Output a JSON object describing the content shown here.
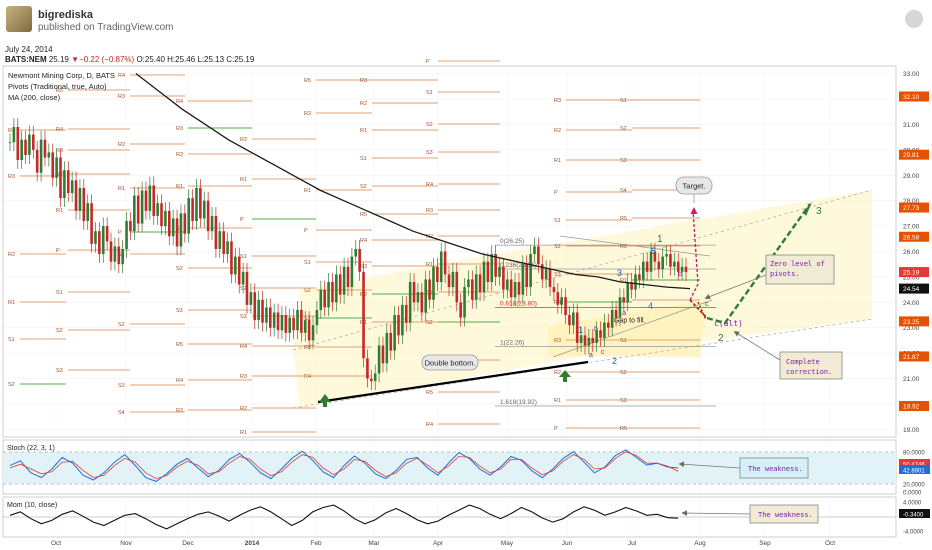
{
  "header": {
    "author": "bigrediska",
    "published": "published on TradingView.com",
    "date": "July 24, 2014",
    "ticker": "BATS:NEM",
    "last": "25.19",
    "change": "▼−0.22 (−0.87%)",
    "ohlc": "O:25.40 H:25.46 L:25.13 C:25.19"
  },
  "legend": {
    "title": "Newmont Mining Corp, D, BATS",
    "pivots": "Pivots (Traditional, true, Auto)",
    "ma": "MA (200, close)"
  },
  "annotations": {
    "target": "Target.",
    "zero_level": "Zero level of pivots.",
    "complete": "Complete correction.",
    "double_bottom": "Double bottom.",
    "gap": "Gap to fill.",
    "calt": "c(alt)",
    "weakness_stoch": "The weakness.",
    "weakness_mom": "The weakness.",
    "fib_0": "0(26.25)",
    "fib_618": "0.618(23.80)",
    "fib_1": "1(22.26)",
    "fib_1618": "1.618(19.92)",
    "fib_236": "0.236(25.31)"
  },
  "pivot_labels": [
    "R4",
    "R3",
    "R2",
    "R1",
    "P",
    "S1",
    "S2",
    "S3",
    "S4",
    "R5",
    "R2",
    "R1",
    "P",
    "S1",
    "S2",
    "S3",
    "R5",
    "R4",
    "R3",
    "R2",
    "R1",
    "S1",
    "S2",
    "R5",
    "R4",
    "R3",
    "R2",
    "R1",
    "P",
    "S1",
    "S2",
    "S3",
    "R4",
    "R3",
    "R2",
    "R1",
    "S1",
    "S2",
    "S3",
    "R5",
    "R4",
    "R3",
    "R2",
    "R1",
    "P",
    "S1",
    "S2",
    "S3"
  ],
  "wave_labels": {
    "w1": "1",
    "w3": "3",
    "w2": "2",
    "w5": "5",
    "w4": "4",
    "wa": "a",
    "wb": "b",
    "wc": "c",
    "big1": "1",
    "big2": "2",
    "big3": "3"
  },
  "chart_data": [
    {
      "type": "line",
      "title": "Newmont Mining Corp, D, BATS",
      "x_tick_labels": [
        "Oct",
        "Nov",
        "Dec",
        "2014",
        "Feb",
        "Mar",
        "Apr",
        "May",
        "Jun",
        "Jul",
        "Aug",
        "Sep",
        "Oct"
      ],
      "y_tick_labels": [
        "33.00",
        "32.00",
        "31.00",
        "30.00",
        "29.00",
        "28.00",
        "27.00",
        "26.00",
        "25.00",
        "24.00",
        "23.00",
        "22.00",
        "21.00",
        "20.00",
        "19.00"
      ],
      "ylim": [
        18.7,
        33.3
      ],
      "price_markers": [
        {
          "label": "32.10",
          "color": "#e65100"
        },
        {
          "label": "29.81",
          "color": "#e65100"
        },
        {
          "label": "27.73",
          "color": "#e65100"
        },
        {
          "label": "26.58",
          "color": "#e65100"
        },
        {
          "label": "25.19",
          "color": "#e53935"
        },
        {
          "label": "24.54",
          "color": "#111111"
        },
        {
          "label": "23.25",
          "color": "#e65100"
        },
        {
          "label": "21.87",
          "color": "#e65100"
        },
        {
          "label": "19.92",
          "color": "#e65100"
        }
      ],
      "series": [
        {
          "name": "NEM",
          "values": [
            30.3,
            30.9,
            29.6,
            30.4,
            29.8,
            30.6,
            30.0,
            29.1,
            30.4,
            29.7,
            29.9,
            28.9,
            29.7,
            28.1,
            29.2,
            28.3,
            28.8,
            27.6,
            28.5,
            27.2,
            27.9,
            26.3,
            26.8,
            25.9,
            27.0,
            26.4,
            25.6,
            26.2,
            25.5,
            26.1,
            27.2,
            26.8,
            28.2,
            27.1,
            28.4,
            27.6,
            28.6,
            27.4,
            27.9,
            27.0,
            27.6,
            26.6,
            27.3,
            26.2,
            27.5,
            26.7,
            28.1,
            27.2,
            28.5,
            27.3,
            28.0,
            26.8,
            27.4,
            26.1,
            26.8,
            25.9,
            26.4,
            25.1,
            25.8,
            24.7,
            25.2,
            23.9,
            24.4,
            23.3,
            24.1,
            23.2,
            23.8,
            23.0,
            23.6,
            22.9,
            23.5,
            22.8,
            23.4,
            22.9,
            23.7,
            22.8,
            23.3,
            22.5,
            23.1,
            23.7,
            24.5,
            23.8,
            24.8,
            24.0,
            25.1,
            24.3,
            25.4,
            24.6,
            25.8,
            26.1,
            25.2,
            21.8,
            21.0,
            20.9,
            21.2,
            22.3,
            21.6,
            22.8,
            22.1,
            23.5,
            22.7,
            23.9,
            23.2,
            24.8,
            24.0,
            24.4,
            23.6,
            24.9,
            24.1,
            25.4,
            24.8,
            26.0,
            25.1,
            24.6,
            25.2,
            24.0,
            23.4,
            24.6,
            24.9,
            24.1,
            25.1,
            24.4,
            25.6,
            24.8,
            25.9,
            25.0,
            25.4,
            24.5,
            24.9,
            24.2,
            24.8,
            24.3,
            25.5,
            24.6,
            25.9,
            26.2,
            25.5,
            24.9,
            25.3,
            24.6,
            24.4,
            23.9,
            24.2,
            23.5,
            23.1,
            23.6,
            22.4,
            22.7,
            22.3,
            22.6,
            22.4,
            22.9,
            22.6,
            23.2,
            23.0,
            23.7,
            23.4,
            24.2,
            24.0,
            24.8,
            24.5,
            25.1,
            24.9,
            25.6,
            25.2,
            26.0,
            25.6,
            25.3,
            25.8,
            25.9,
            25.4,
            25.6,
            25.2,
            25.4,
            25.19
          ]
        },
        {
          "name": "MA (200, close)",
          "values": [
            33.0,
            32.3,
            31.6,
            31.0,
            30.4,
            29.9,
            29.4,
            28.9,
            28.4,
            28.0,
            27.6,
            27.2,
            26.8,
            26.5,
            26.2,
            25.9,
            25.7,
            25.5,
            25.3,
            25.1,
            25.0,
            24.8,
            24.7,
            24.6,
            24.54
          ]
        }
      ]
    },
    {
      "type": "line",
      "title": "Stoch (22, 3, 1)",
      "y_tick_labels": [
        "80.0000",
        "50.4746",
        "42.8901",
        "20.0000",
        "0.0000"
      ],
      "ylim": [
        0,
        100
      ],
      "series": [
        {
          "name": "K",
          "values": [
            55,
            65,
            40,
            30,
            48,
            72,
            60,
            35,
            25,
            40,
            62,
            78,
            55,
            30,
            22,
            38,
            58,
            70,
            50,
            32,
            45,
            68,
            80,
            62,
            40,
            28,
            48,
            70,
            85,
            66,
            42,
            30,
            55,
            75,
            60,
            38,
            28,
            45,
            68,
            72,
            50,
            35,
            60,
            82,
            70,
            48,
            35,
            52,
            74,
            66,
            44,
            30,
            48,
            70,
            84,
            62,
            40,
            52,
            76,
            88,
            72,
            56,
            60,
            52,
            50
          ]
        },
        {
          "name": "D",
          "values": [
            50,
            58,
            48,
            38,
            42,
            62,
            64,
            45,
            30,
            35,
            55,
            70,
            62,
            40,
            28,
            34,
            52,
            64,
            56,
            38,
            42,
            60,
            74,
            68,
            48,
            34,
            42,
            62,
            78,
            72,
            50,
            36,
            48,
            68,
            64,
            45,
            32,
            40,
            60,
            70,
            56,
            40,
            54,
            74,
            72,
            54,
            40,
            48,
            68,
            68,
            50,
            36,
            44,
            64,
            78,
            68,
            48,
            50,
            70,
            84,
            76,
            60,
            60,
            54,
            43
          ]
        }
      ]
    },
    {
      "type": "line",
      "title": "Mom (10, close)",
      "y_tick_labels": [
        "4.0000",
        "0.0000",
        "-0.3400",
        "-4.0000"
      ],
      "ylim": [
        -5,
        5
      ],
      "series": [
        {
          "name": "Mom",
          "values": [
            0.5,
            1.5,
            -0.5,
            -2.0,
            -1.0,
            0.8,
            1.8,
            0.2,
            -1.5,
            -2.5,
            -1.0,
            0.5,
            1.0,
            -0.5,
            -2.2,
            -3.5,
            -2.0,
            -0.5,
            0.8,
            1.5,
            0.3,
            -1.2,
            0.5,
            2.0,
            3.0,
            1.5,
            -0.5,
            -2.5,
            -1.0,
            1.5,
            2.8,
            3.5,
            1.8,
            -0.5,
            -2.0,
            -0.8,
            1.2,
            2.5,
            1.0,
            -0.8,
            -2.0,
            -1.2,
            0.5,
            2.0,
            3.5,
            2.5,
            0.8,
            -0.5,
            1.0,
            2.8,
            1.5,
            -0.3,
            -1.5,
            -0.5,
            1.5,
            3.0,
            2.0,
            0.5,
            1.5,
            2.8,
            1.8,
            0.5,
            0.8,
            -0.2,
            -0.34
          ]
        }
      ]
    }
  ]
}
